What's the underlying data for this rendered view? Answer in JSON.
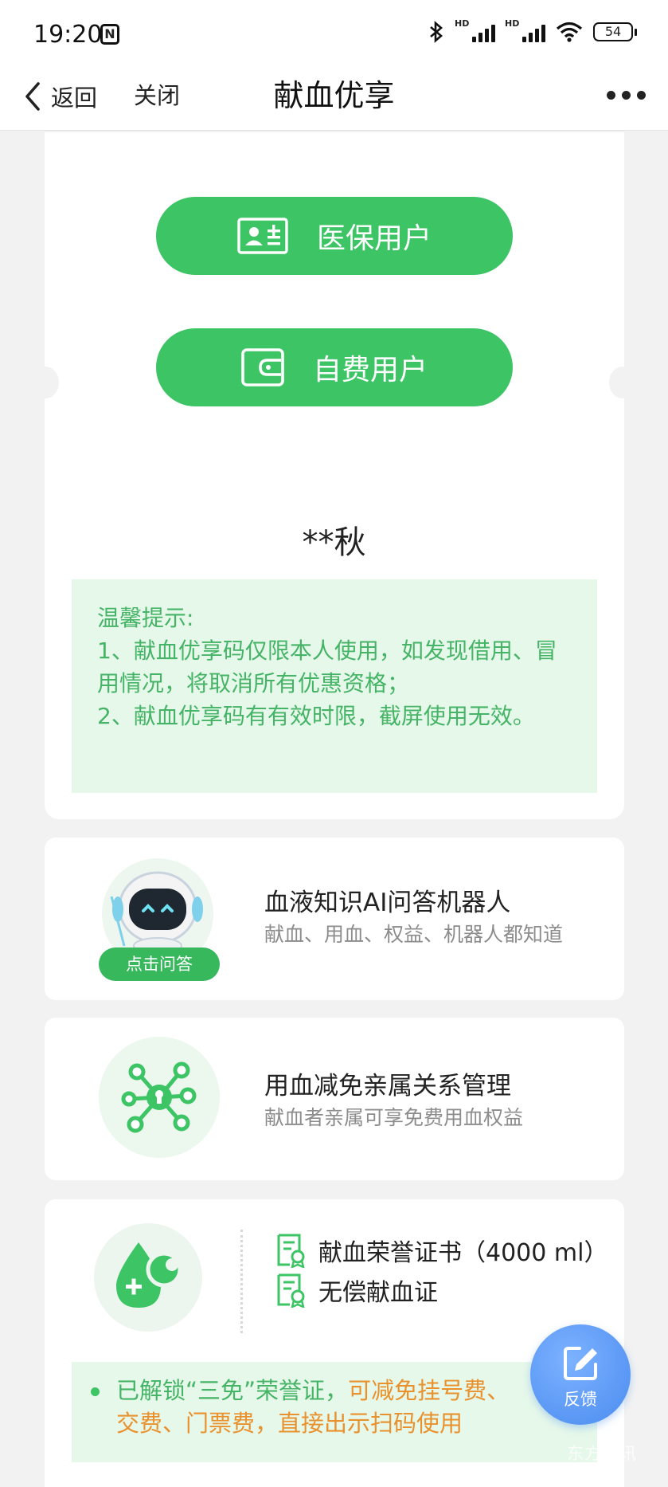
{
  "status_bar": {
    "time": "19:20",
    "nfc": "N",
    "hd1": "HD",
    "hd2": "HD",
    "battery": "54"
  },
  "nav": {
    "back_label": "返回",
    "close_label": "关闭",
    "title": "献血优享"
  },
  "buttons": {
    "medical_insurance": "医保用户",
    "self_pay": "自费用户"
  },
  "user_name": "**秋",
  "tips": {
    "heading": "温馨提示:",
    "line1": "1、献血优享码仅限本人使用，如发现借用、冒用情况，将取消所有优惠资格；",
    "line2": "2、献血优享码有有效时限，截屏使用无效。"
  },
  "features": [
    {
      "title": "血液知识AI问答机器人",
      "subtitle": "献血、用血、权益、机器人都知道",
      "badge": "点击问答",
      "icon": "robot-icon"
    },
    {
      "title": "用血减免亲属关系管理",
      "subtitle": "献血者亲属可享免费用血权益",
      "icon": "family-network-icon"
    }
  ],
  "certificates": {
    "items": [
      "献血荣誉证书（4000 ml）",
      "无偿献血证"
    ],
    "note_green": "已解锁“三免”荣誉证，",
    "note_orange": "可减免挂号费、",
    "note_line2": "交费、门票费，直接出示扫码使用",
    "icon": "blood-drop-plus-icon"
  },
  "fab": {
    "label": "反馈",
    "icon": "edit-icon"
  },
  "watermark": "东方资讯",
  "colors": {
    "primary_green": "#3cc465",
    "tip_bg": "#e6f8ea",
    "tip_text": "#45b466",
    "orange": "#e8912d",
    "fab_blue": "#4a8cf0"
  }
}
